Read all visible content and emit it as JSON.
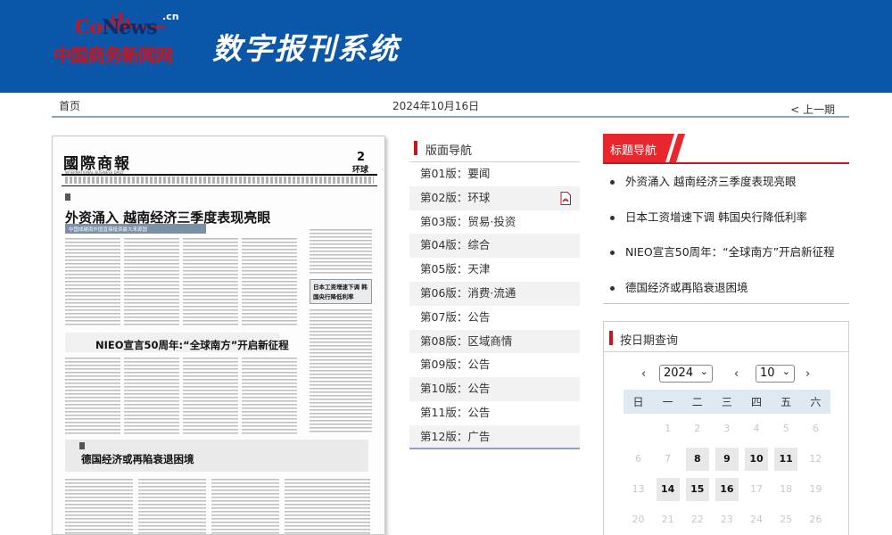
{
  "header": {
    "logo_brand_co": "Co",
    "logo_brand_news": "News",
    "logo_domain": ".cn",
    "logo_name": "中国商务新闻网",
    "site_title": "数字报刊系统",
    "bg_color": "#0a56a8"
  },
  "subnav": {
    "home_label": "首页",
    "date": "2024年10月16日",
    "prev_label": "< 上一期"
  },
  "newspaper": {
    "masthead": "國際商報",
    "subtitle": "INTERNATIONAL BUSINESS DAILY",
    "page_number": "2",
    "section": "环球",
    "headline_1": "外资涌入  越南经济三季度表现亮眼",
    "headline_1_sub": "中国成越南外国直接投资最大来源国",
    "headline_2": "NIEO宣言50周年:“全球南方”开启新征程",
    "headline_3": "德国经济或再陷衰退困境",
    "box_text": "日本工资增速下调 韩国央行降低利率"
  },
  "layout_nav": {
    "title": "版面导航",
    "pages": [
      {
        "label": "第01版：要闻"
      },
      {
        "label": "第02版：环球"
      },
      {
        "label": "第03版：贸易·投资"
      },
      {
        "label": "第04版：综合"
      },
      {
        "label": "第05版：天津"
      },
      {
        "label": "第06版：消费·流通"
      },
      {
        "label": "第07版：公告"
      },
      {
        "label": "第08版：区域商情"
      },
      {
        "label": "第09版：公告"
      },
      {
        "label": "第10版：公告"
      },
      {
        "label": "第11版：公告"
      },
      {
        "label": "第12版：广告"
      }
    ],
    "pdf_icon": "pdf-file-icon",
    "accent": "#c9151e"
  },
  "title_nav": {
    "title": "标题导航",
    "items": [
      {
        "label": "外资涌入 越南经济三季度表现亮眼"
      },
      {
        "label": "日本工资增速下调 韩国央行降低利率"
      },
      {
        "label": "NIEO宣言50周年：“全球南方”开启新征程"
      },
      {
        "label": "德国经济或再陷衰退困境"
      }
    ],
    "accent": "#e8262d"
  },
  "date_query": {
    "title": "按日期查询",
    "prev_month": "‹",
    "prev_year": "‹",
    "next_year": "›",
    "next_month": "›",
    "year_value": "2024",
    "month_value": "10",
    "weekdays": [
      "日",
      "一",
      "二",
      "三",
      "四",
      "五",
      "六"
    ],
    "weeks": [
      [
        {
          "d": ""
        },
        {
          "d": "1"
        },
        {
          "d": "2"
        },
        {
          "d": "3"
        },
        {
          "d": "4"
        },
        {
          "d": "5"
        },
        {
          "d": "6"
        }
      ],
      [
        {
          "d": "6"
        },
        {
          "d": "7"
        },
        {
          "d": "8",
          "on": true
        },
        {
          "d": "9",
          "on": true
        },
        {
          "d": "10",
          "on": true
        },
        {
          "d": "11",
          "on": true
        },
        {
          "d": "12"
        }
      ],
      [
        {
          "d": "13"
        },
        {
          "d": "14",
          "on": true
        },
        {
          "d": "15",
          "on": true
        },
        {
          "d": "16",
          "on": true
        },
        {
          "d": "17"
        },
        {
          "d": "18"
        },
        {
          "d": "19"
        }
      ],
      [
        {
          "d": "20"
        },
        {
          "d": "21"
        },
        {
          "d": "22"
        },
        {
          "d": "23"
        },
        {
          "d": "24"
        },
        {
          "d": "25"
        },
        {
          "d": "26"
        }
      ]
    ]
  }
}
